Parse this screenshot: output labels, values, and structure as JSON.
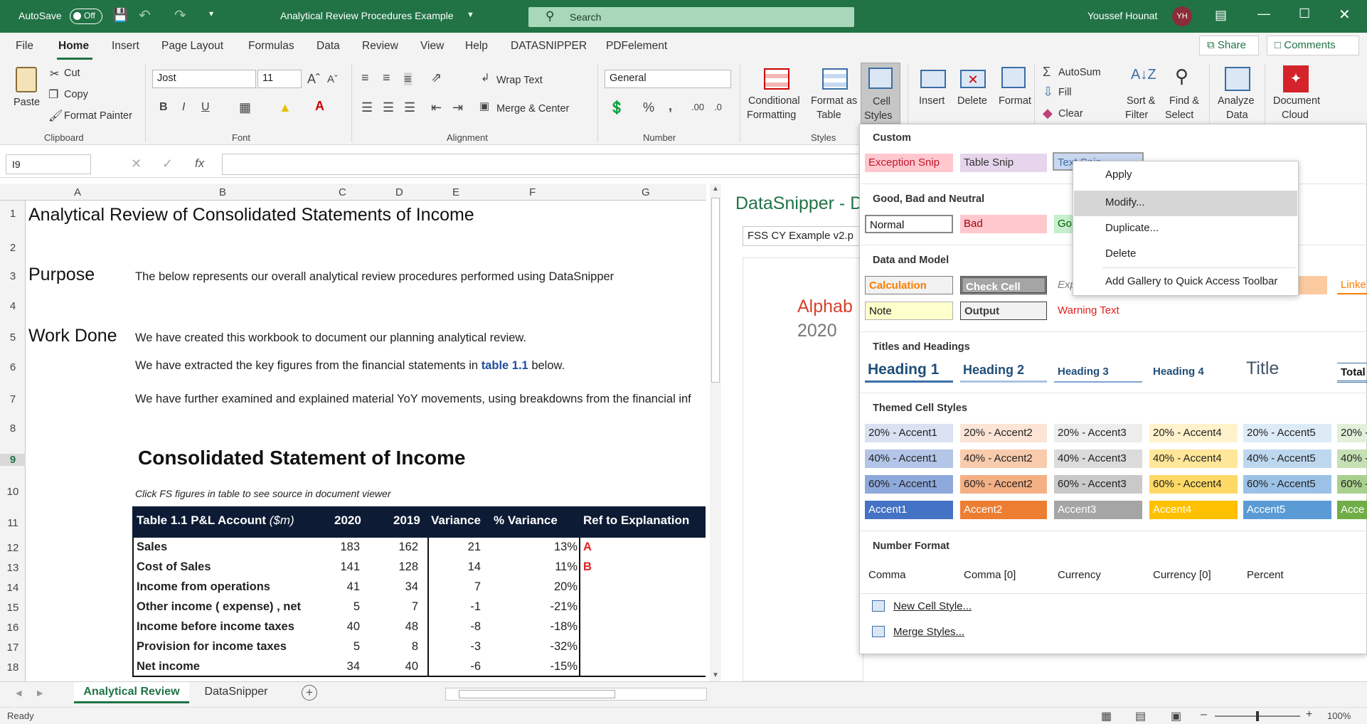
{
  "titlebar": {
    "autosave_label": "AutoSave",
    "autosave_state": "Off",
    "document_title": "Analytical Review Procedures Example",
    "search_placeholder": "Search",
    "user_name": "Youssef Hounat",
    "user_initials": "YH"
  },
  "menu": {
    "tabs": [
      "File",
      "Home",
      "Insert",
      "Page Layout",
      "Formulas",
      "Data",
      "Review",
      "View",
      "Help",
      "DATASNIPPER",
      "PDFelement"
    ],
    "share_label": "Share",
    "comments_label": "Comments"
  },
  "ribbon": {
    "clipboard": {
      "paste": "Paste",
      "cut": "Cut",
      "copy": "Copy",
      "format_painter": "Format Painter",
      "group": "Clipboard"
    },
    "font": {
      "name": "Jost",
      "size": "11",
      "group": "Font"
    },
    "alignment": {
      "wrap_text": "Wrap Text",
      "merge_center": "Merge & Center",
      "group": "Alignment"
    },
    "number": {
      "format": "General",
      "group": "Number"
    },
    "styles": {
      "conditional_1": "Conditional",
      "conditional_2": "Formatting",
      "format_table_1": "Format as",
      "format_table_2": "Table",
      "cell_styles_1": "Cell",
      "cell_styles_2": "Styles",
      "group": "Styles"
    },
    "cells": {
      "insert": "Insert",
      "delete": "Delete",
      "format": "Format"
    },
    "editing": {
      "autosum": "AutoSum",
      "fill": "Fill",
      "clear": "Clear",
      "sort_1": "Sort &",
      "sort_2": "Filter",
      "find_1": "Find &",
      "find_2": "Select"
    },
    "analyze_1": "Analyze",
    "analyze_2": "Data",
    "doc_cloud_1": "Document",
    "doc_cloud_2": "Cloud"
  },
  "formula_bar": {
    "name_box": "I9",
    "fx": "fx"
  },
  "columns": [
    "A",
    "B",
    "C",
    "D",
    "E",
    "F",
    "G"
  ],
  "rows": [
    "1",
    "2",
    "3",
    "4",
    "5",
    "6",
    "7",
    "8",
    "9",
    "10",
    "11",
    "12",
    "13",
    "14",
    "15",
    "16",
    "17",
    "18"
  ],
  "sheet": {
    "title": "Analytical Review of Consolidated Statements of Income",
    "purpose_label": "Purpose",
    "purpose_text": "The below represents our overall analytical review procedures performed using DataSnipper",
    "work_done_label": "Work Done",
    "work_done_1": "We have created this workbook to document our planning analytical review.",
    "work_done_2_pre": "We have extracted the key figures from the financial statements in ",
    "work_done_2_link": "table 1.1",
    "work_done_2_post": " below.",
    "work_done_3": "We have further examined and explained material YoY movements, using breakdowns from the financial inf",
    "section_title": "Consolidated Statement of Income",
    "hint": "Click FS figures in table to see source in document viewer",
    "table": {
      "headers": {
        "account": "Table 1.1 P&L Account ",
        "unit": "($m)",
        "y2020": "2020",
        "y2019": "2019",
        "variance": "Variance",
        "pct": "% Variance",
        "ref": "Ref to Explanation"
      },
      "rows": [
        {
          "label": "Sales",
          "y2020": "183",
          "y2019": "162",
          "var": "21",
          "pct": "13%",
          "ref": "A"
        },
        {
          "label": "Cost of Sales",
          "y2020": "141",
          "y2019": "128",
          "var": "14",
          "pct": "11%",
          "ref": "B"
        },
        {
          "label": "Income from operations",
          "y2020": "41",
          "y2019": "34",
          "var": "7",
          "pct": "20%",
          "ref": ""
        },
        {
          "label": "Other income ( expense) , net",
          "y2020": "5",
          "y2019": "7",
          "var": "-1",
          "pct": "-21%",
          "ref": ""
        },
        {
          "label": "Income before income taxes",
          "y2020": "40",
          "y2019": "48",
          "var": "-8",
          "pct": "-18%",
          "ref": ""
        },
        {
          "label": "Provision for income taxes",
          "y2020": "5",
          "y2019": "8",
          "var": "-3",
          "pct": "-32%",
          "ref": ""
        },
        {
          "label": "Net income",
          "y2020": "34",
          "y2019": "40",
          "var": "-6",
          "pct": "-15%",
          "ref": ""
        }
      ]
    }
  },
  "datasnipper_pane": {
    "title": "DataSnipper - D",
    "file": "FSS CY Example v2.p",
    "doc_line1": "Alphab",
    "doc_line2": "2020"
  },
  "sheet_tabs": [
    "Analytical Review",
    "DataSnipper"
  ],
  "status": {
    "ready": "Ready",
    "zoom": "100%"
  },
  "cell_styles": {
    "custom_header": "Custom",
    "custom": [
      "Exception Snip",
      "Table Snip",
      "Text Snip"
    ],
    "good_bad_header": "Good, Bad and Neutral",
    "good_bad": [
      "Normal",
      "Bad",
      "Go"
    ],
    "data_model_header": "Data and Model",
    "data_model_row1": [
      "Calculation",
      "Check Cell",
      "Exp",
      "Linke"
    ],
    "data_model_row2": [
      "Note",
      "Output",
      "Warning Text"
    ],
    "titles_header": "Titles and Headings",
    "titles": [
      "Heading 1",
      "Heading 2",
      "Heading 3",
      "Heading 4",
      "Title",
      "Total"
    ],
    "themed_header": "Themed Cell Styles",
    "themed_20": [
      "20% - Accent1",
      "20% - Accent2",
      "20% - Accent3",
      "20% - Accent4",
      "20% - Accent5",
      "20% -"
    ],
    "themed_40": [
      "40% - Accent1",
      "40% - Accent2",
      "40% - Accent3",
      "40% - Accent4",
      "40% - Accent5",
      "40% -"
    ],
    "themed_60": [
      "60% - Accent1",
      "60% - Accent2",
      "60% - Accent3",
      "60% - Accent4",
      "60% - Accent5",
      "60% -"
    ],
    "accents": [
      "Accent1",
      "Accent2",
      "Accent3",
      "Accent4",
      "Accent5",
      "Acce"
    ],
    "number_header": "Number Format",
    "number_formats": [
      "Comma",
      "Comma [0]",
      "Currency",
      "Currency [0]",
      "Percent"
    ],
    "new_style": "New Cell Style...",
    "merge_styles": "Merge Styles..."
  },
  "context_menu": {
    "apply": "Apply",
    "modify": "Modify...",
    "duplicate": "Duplicate...",
    "delete": "Delete",
    "add_gallery": "Add Gallery to Quick Access Toolbar"
  },
  "colors": {
    "excel_green": "#217346",
    "table_header": "#0d1b34",
    "link_blue": "#1f4e9a",
    "ref_red": "#e02020"
  }
}
